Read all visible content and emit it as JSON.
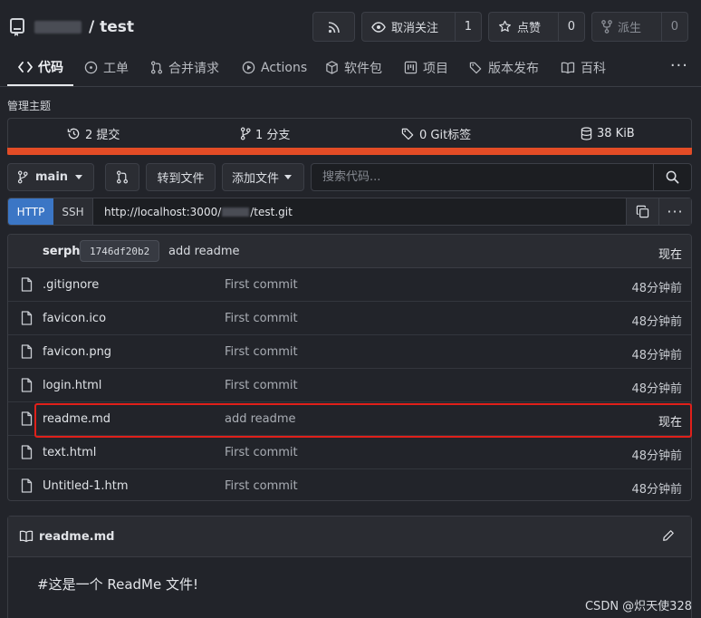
{
  "repo": {
    "owner": "",
    "name": "/ test"
  },
  "header_buttons": {
    "rss_icon": "rss-icon",
    "watch": {
      "label": "取消关注",
      "count": "1"
    },
    "star": {
      "label": "点赞",
      "count": "0"
    },
    "fork": {
      "label": "派生",
      "count": "0"
    }
  },
  "tabs": [
    {
      "label": "代码",
      "icon": "code-icon",
      "active": true
    },
    {
      "label": "工单",
      "icon": "issue-icon"
    },
    {
      "label": "合并请求",
      "icon": "pull-request-icon"
    },
    {
      "label": "Actions",
      "icon": "play-icon"
    },
    {
      "label": "软件包",
      "icon": "package-icon"
    },
    {
      "label": "项目",
      "icon": "project-icon"
    },
    {
      "label": "版本发布",
      "icon": "tag-icon"
    },
    {
      "label": "百科",
      "icon": "book-icon"
    }
  ],
  "tabs_more": "···",
  "topics_label": "管理主题",
  "stats": {
    "commits": "2 提交",
    "branches": "1 分支",
    "tags": "0 Git标签",
    "size": "38 KiB"
  },
  "language_bar_color": "#e34c26",
  "toolbar": {
    "branch": "main",
    "goto_file": "转到文件",
    "add_file": "添加文件",
    "search_placeholder": "搜索代码..."
  },
  "clone": {
    "http": "HTTP",
    "ssh": "SSH",
    "url_prefix": "http://localhost:3000/",
    "url_suffix": "/test.git"
  },
  "latest_commit": {
    "author": "serph",
    "sha": "1746df20b2",
    "message": "add readme",
    "time": "现在"
  },
  "files": [
    {
      "name": ".gitignore",
      "message": "First commit",
      "time": "48分钟前"
    },
    {
      "name": "favicon.ico",
      "message": "First commit",
      "time": "48分钟前"
    },
    {
      "name": "favicon.png",
      "message": "First commit",
      "time": "48分钟前"
    },
    {
      "name": "login.html",
      "message": "First commit",
      "time": "48分钟前"
    },
    {
      "name": "readme.md",
      "message": "add readme",
      "time": "现在"
    },
    {
      "name": "text.html",
      "message": "First commit",
      "time": "48分钟前"
    },
    {
      "name": "Untitled-1.htm",
      "message": "First commit",
      "time": "48分钟前"
    }
  ],
  "highlight_color": "#e0201a",
  "readme": {
    "title": "readme.md",
    "body": "#这是一个 ReadMe 文件!"
  },
  "watermark": "CSDN @炽天使328"
}
